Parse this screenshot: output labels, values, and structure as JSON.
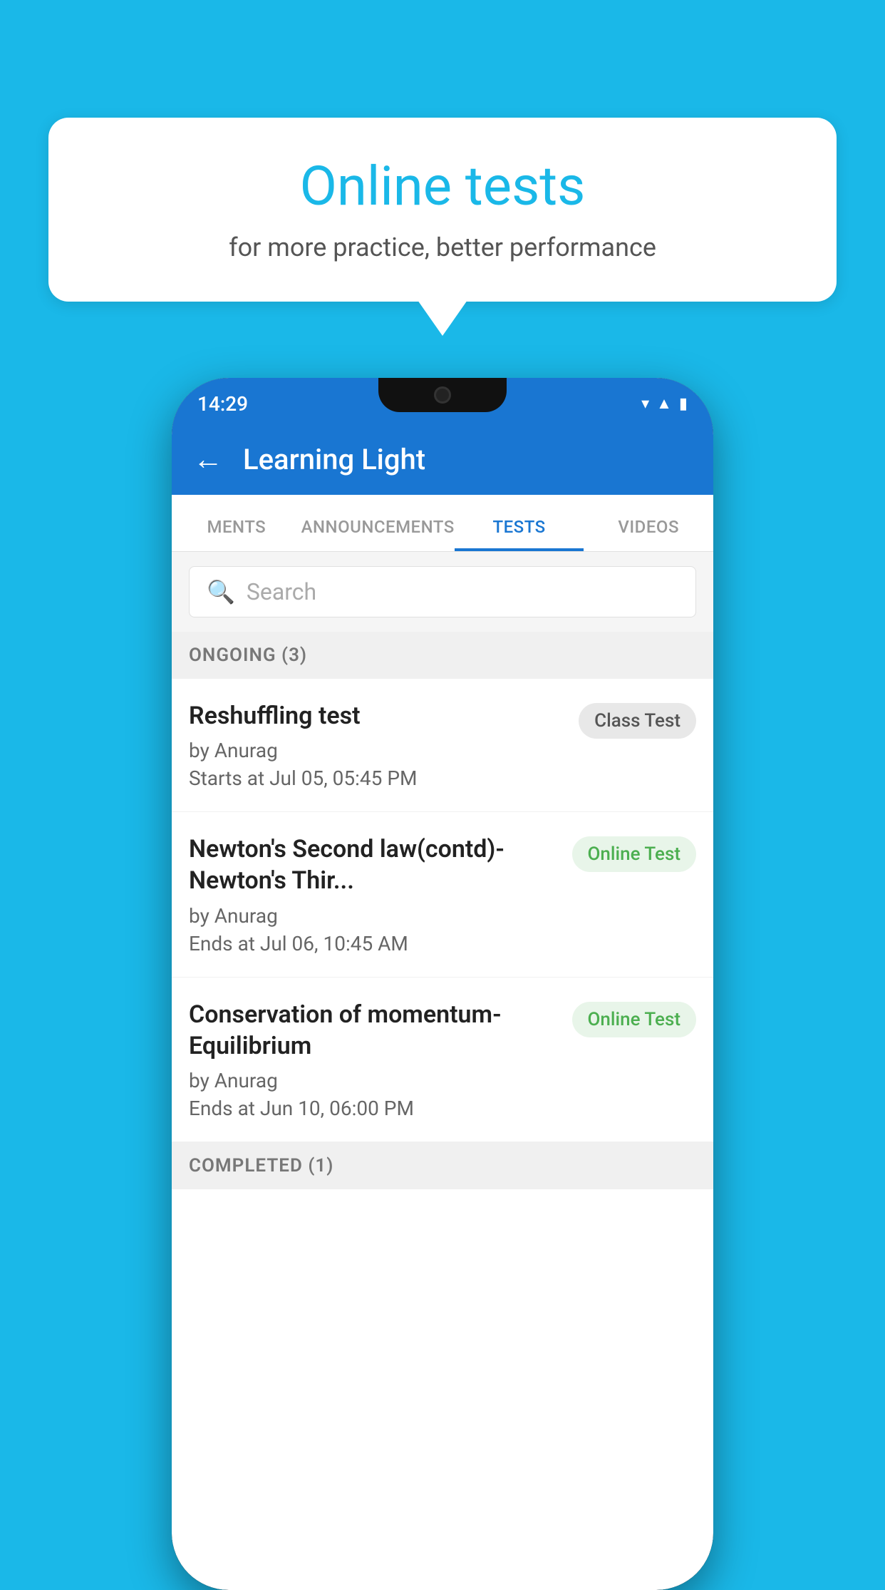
{
  "background": {
    "color": "#1ab8e8"
  },
  "speech_bubble": {
    "title": "Online tests",
    "subtitle": "for more practice, better performance"
  },
  "phone": {
    "status_bar": {
      "time": "14:29",
      "icons": [
        "wifi",
        "signal",
        "battery"
      ]
    },
    "header": {
      "back_label": "←",
      "title": "Learning Light"
    },
    "tabs": [
      {
        "label": "MENTS",
        "active": false
      },
      {
        "label": "ANNOUNCEMENTS",
        "active": false
      },
      {
        "label": "TESTS",
        "active": true
      },
      {
        "label": "VIDEOS",
        "active": false
      }
    ],
    "search": {
      "placeholder": "Search"
    },
    "sections": [
      {
        "header": "ONGOING (3)",
        "tests": [
          {
            "name": "Reshuffling test",
            "author": "by Anurag",
            "date": "Starts at  Jul 05, 05:45 PM",
            "badge": "Class Test",
            "badge_type": "class"
          },
          {
            "name": "Newton's Second law(contd)-Newton's Thir...",
            "author": "by Anurag",
            "date": "Ends at  Jul 06, 10:45 AM",
            "badge": "Online Test",
            "badge_type": "online"
          },
          {
            "name": "Conservation of momentum-Equilibrium",
            "author": "by Anurag",
            "date": "Ends at  Jun 10, 06:00 PM",
            "badge": "Online Test",
            "badge_type": "online"
          }
        ]
      },
      {
        "header": "COMPLETED (1)",
        "tests": []
      }
    ]
  }
}
